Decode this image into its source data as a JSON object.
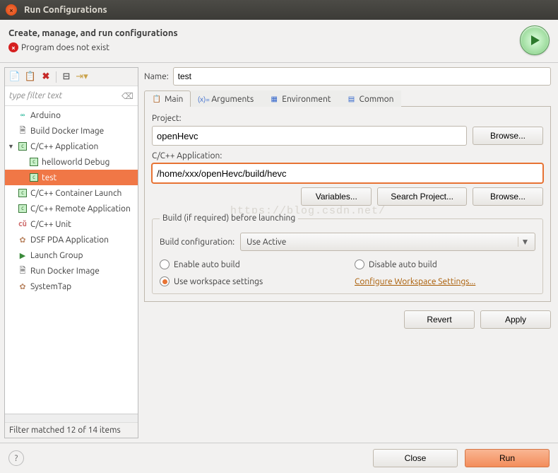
{
  "window": {
    "title": "Run Configurations"
  },
  "header": {
    "title": "Create, manage, and run configurations",
    "error": "Program does not exist"
  },
  "filter": {
    "placeholder": "type filter text",
    "status": "Filter matched 12 of 14 items"
  },
  "tree": {
    "items": [
      {
        "label": "Arduino"
      },
      {
        "label": "Build Docker Image"
      },
      {
        "label": "C/C++ Application",
        "expanded": true
      },
      {
        "label": "helloworld Debug"
      },
      {
        "label": "test",
        "selected": true
      },
      {
        "label": "C/C++ Container Launch"
      },
      {
        "label": "C/C++ Remote Application"
      },
      {
        "label": "C/C++ Unit"
      },
      {
        "label": "DSF PDA Application"
      },
      {
        "label": "Launch Group"
      },
      {
        "label": "Run Docker Image"
      },
      {
        "label": "SystemTap"
      }
    ]
  },
  "form": {
    "name_label": "Name:",
    "name_value": "test",
    "tabs": {
      "main": "Main",
      "args": "Arguments",
      "env": "Environment",
      "common": "Common"
    },
    "project_label": "Project:",
    "project_value": "openHevc",
    "app_label": "C/C++ Application:",
    "app_value": "/home/xxx/openHevc/build/hevc",
    "btn_browse": "Browse...",
    "btn_variables": "Variables...",
    "btn_search": "Search Project...",
    "build_group": "Build (if required) before launching",
    "build_conf_label": "Build configuration:",
    "build_conf_value": "Use Active",
    "opt_enable": "Enable auto build",
    "opt_disable": "Disable auto build",
    "opt_workspace": "Use workspace settings",
    "link_conf": "Configure Workspace Settings...",
    "watermark": "https://blog.csdn.net/"
  },
  "actions": {
    "revert": "Revert",
    "apply": "Apply",
    "close": "Close",
    "run": "Run"
  }
}
